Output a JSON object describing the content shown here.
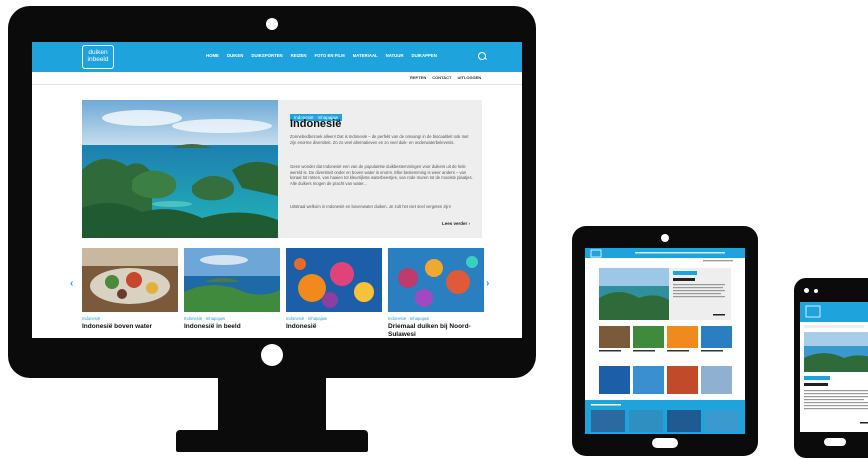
{
  "site": {
    "logo_line1": "duiken",
    "logo_line2": "inbeeld",
    "nav": [
      "HOME",
      "DUIKEN",
      "DUIKSPORTEN",
      "REIZEN",
      "FOTO EN FILM",
      "MATERIAAL",
      "NATUUR",
      "DUIKAPPEN"
    ],
    "subnav": [
      "REPTEN",
      "CONTACT",
      "UITLOGGEN"
    ]
  },
  "hero": {
    "tag": "Indonesië · Inhapajaw",
    "title": "Indonesië",
    "p1": "Zonnebedbezoek alleen! Dat is Indonesië – de perfekt van de omvang! in de biocaaliteit ook met zijn enorme diversiteit. Zo zo veel alternatieven en zo veel duik- en onderwaterbelevenis.",
    "p2": "Geen wonder dat Indonesië een van de populairste duikbestemmingen voor duikers uit de hele wereld is. De diversiteit onder en boven water is enorm. Elke bestemming is weer anders – van koraal tot rotsen, van haaien tot kleurrijkste waterbeestjes, van rode muren tot de mooiste plaatjes. Alle duikers mogen de pracht van water...",
    "p3": "Uitstraal welkom in Indonesië en bovenwater duiken. Je zult het niet snel vergeten zijn!",
    "more": "Lees verder ›"
  },
  "cards": [
    {
      "tag": "Indonesië",
      "title": "Indonesië boven water"
    },
    {
      "tag": "Indonesië · Inhapajaw",
      "title": "Indonesië in beeld"
    },
    {
      "tag": "Indonesië · Inhapajaw",
      "title": "Indonesië"
    },
    {
      "tag": "Indonesië · Inhapajaw",
      "title": "Driemaal duiken bij Noord-Sulawesi"
    }
  ],
  "arrows": {
    "left": "‹",
    "right": "›"
  },
  "colors": {
    "brand": "#1fa3dd",
    "device": "#0b0b0b"
  }
}
